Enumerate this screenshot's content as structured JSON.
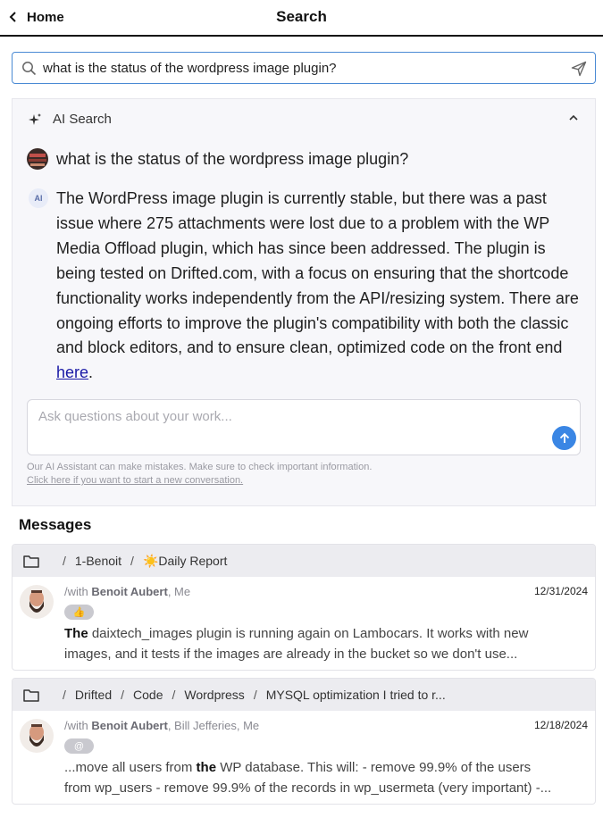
{
  "header": {
    "back_label": "Home",
    "title": "Search"
  },
  "search": {
    "value": "what is the status of the wordpress image plugin?",
    "placeholder": ""
  },
  "ai_panel": {
    "header_label": "AI Search",
    "question": "what is the status of the wordpress image plugin?",
    "badge": "AI",
    "answer_text": "The WordPress image plugin is currently stable, but there was a past issue where 275 attachments were lost due to a problem with the WP Media Offload plugin, which has since been addressed. The plugin is being tested on Drifted.com, with a focus on ensuring that the shortcode functionality works independently from the API/resizing system. There are ongoing efforts to improve the plugin's compatibility with both the classic and block editors, and to ensure clean, optimized code on the front end ",
    "answer_link": "here",
    "answer_end": ".",
    "ask_placeholder": "Ask questions about your work...",
    "disclaimer": "Our AI Assistant can make mistakes. Make sure to check important information.",
    "new_conversation": "Click here if you want to start a new conversation."
  },
  "messages": {
    "heading": "Messages",
    "cards": [
      {
        "crumbs": [
          "1-Benoit",
          "☀️Daily Report"
        ],
        "with_prefix": "/with ",
        "with_bold": "Benoit Aubert",
        "with_rest": ", Me",
        "date": "12/31/2024",
        "reaction": "👍",
        "snippet_bold": "The",
        "snippet_line1": " daixtech_images plugin is running again on Lambocars. It works with new",
        "snippet_line2": "images, and it tests if the images are already in the bucket so we don't use..."
      },
      {
        "crumbs": [
          "Drifted",
          "Code",
          "Wordpress",
          "MYSQL optimization I tried to r..."
        ],
        "with_prefix": "/with ",
        "with_bold": "Benoit Aubert",
        "with_rest": ", Bill Jefferies, Me",
        "date": "12/18/2024",
        "reaction": "@",
        "snippet_pre": "...move all users from ",
        "snippet_bold": "the",
        "snippet_line1": " WP database. This will: - remove 99.9% of the users",
        "snippet_line2": "from wp_users - remove 99.9% of the records in wp_usermeta (very important) -..."
      }
    ]
  },
  "colors": {
    "accent": "#3a86e4",
    "search_border": "#4a8ad4",
    "panel_bg": "#f7f7fa",
    "card_head_bg": "#ececf0"
  },
  "icons": [
    "chevron-left-icon",
    "search-icon",
    "send-icon",
    "sparkle-icon",
    "chevron-up-icon",
    "arrow-up-icon",
    "folder-icon"
  ]
}
